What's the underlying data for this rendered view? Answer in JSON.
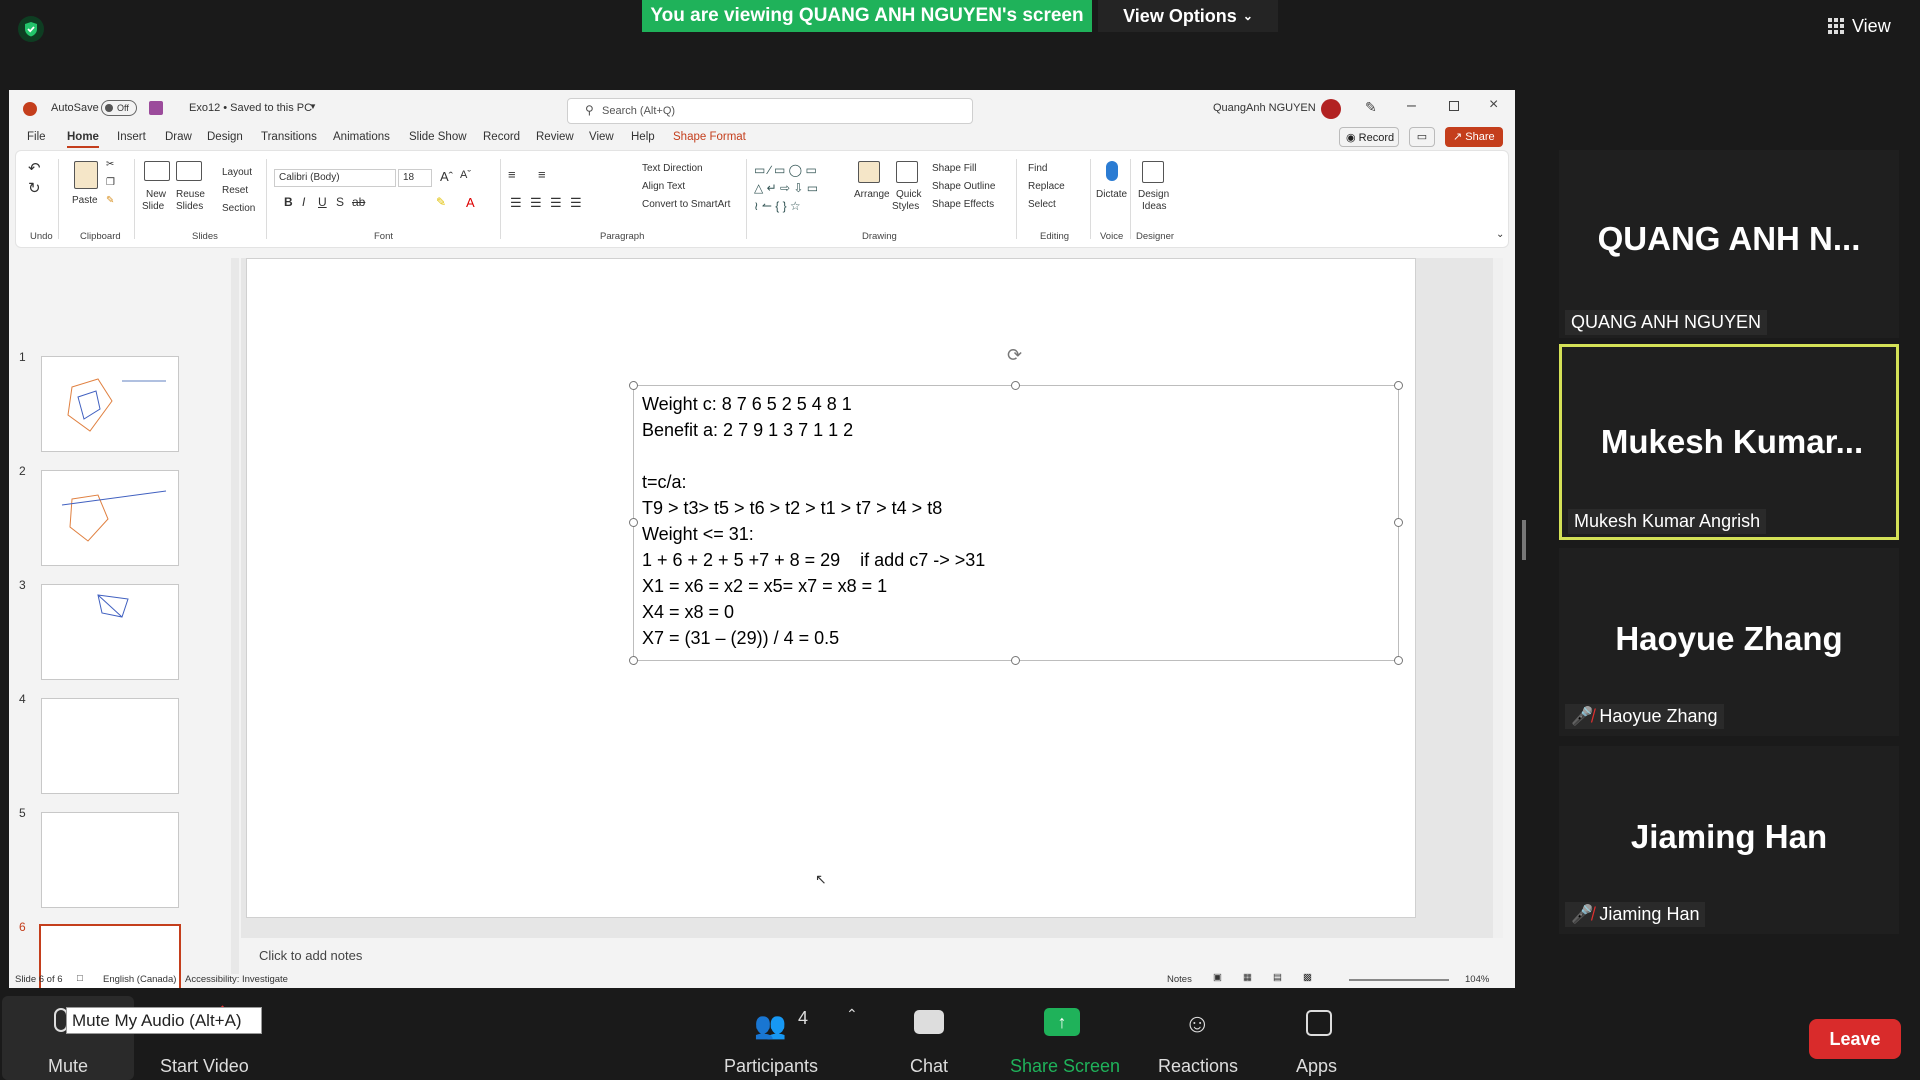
{
  "zoom": {
    "banner": "You are viewing QUANG ANH NGUYEN's screen",
    "view_options": "View Options",
    "view": "View",
    "participants": [
      {
        "big_name": "QUANG ANH N...",
        "label": "QUANG ANH NGUYEN",
        "muted": false
      },
      {
        "big_name": "Mukesh  Kumar...",
        "label": "Mukesh Kumar Angrish",
        "muted": false,
        "active_speaker": true
      },
      {
        "big_name": "Haoyue Zhang",
        "label": "Haoyue Zhang",
        "muted": true
      },
      {
        "big_name": "Jiaming Han",
        "label": "Jiaming Han",
        "muted": true
      }
    ],
    "toolbar": {
      "mute": "Mute",
      "tooltip": "Mute My Audio (Alt+A)",
      "start_video": "Start Video",
      "participants": "Participants",
      "participants_count": "4",
      "chat": "Chat",
      "share_screen": "Share Screen",
      "reactions": "Reactions",
      "apps": "Apps",
      "leave": "Leave"
    },
    "colors": {
      "banner": "#1fb25a",
      "leave": "#d92b2b",
      "active_border": "#d4e157"
    }
  },
  "ppt": {
    "autosave": "AutoSave",
    "autosave_state": "Off",
    "filename": "Exo12 • Saved to this PC",
    "search_placeholder": "Search (Alt+Q)",
    "user": "QuangAnh NGUYEN",
    "tabs": [
      "File",
      "Home",
      "Insert",
      "Draw",
      "Design",
      "Transitions",
      "Animations",
      "Slide Show",
      "Record",
      "Review",
      "View",
      "Help",
      "Shape Format"
    ],
    "active_tab": "Home",
    "record_btn": "Record",
    "share_btn": "Share",
    "ribbon": {
      "undo": "Undo",
      "paste": "Paste",
      "clipboard": "Clipboard",
      "new_slide": "New",
      "new_slide2": "Slide",
      "reuse": "Reuse",
      "reuse2": "Slides",
      "layout": "Layout",
      "reset": "Reset",
      "section": "Section",
      "slides": "Slides",
      "font_name": "Calibri (Body)",
      "font_size": "18",
      "font": "Font",
      "text_direction": "Text Direction",
      "align_text": "Align Text",
      "convert_smartart": "Convert to SmartArt",
      "paragraph": "Paragraph",
      "arrange": "Arrange",
      "quick_styles": "Quick",
      "quick_styles2": "Styles",
      "shape_fill": "Shape Fill",
      "shape_outline": "Shape Outline",
      "shape_effects": "Shape Effects",
      "drawing": "Drawing",
      "find": "Find",
      "replace": "Replace",
      "select": "Select",
      "editing": "Editing",
      "dictate": "Dictate",
      "voice": "Voice",
      "design_ideas": "Design",
      "design_ideas2": "Ideas",
      "designer": "Designer"
    },
    "thumbnails": [
      "1",
      "2",
      "3",
      "4",
      "5",
      "6"
    ],
    "selected_slide": "6",
    "slide_text": [
      "Weight c: 8 7 6 5 2 5 4 8 1",
      "Benefit a: 2 7 9 1 3 7 1 1 2",
      "",
      "t=c/a:",
      "T9 > t3> t5 > t6 > t2 > t1 > t7 > t4 > t8",
      "Weight <= 31:",
      "1 + 6 + 2 + 5 +7 + 8 = 29    if add c7 -> >31",
      "X1 = x6 = x2 = x5= x7 = x8 = 1",
      "X4 = x8 = 0",
      "X7 = (31 – (29)) / 4 = 0.5"
    ],
    "notes_placeholder": "Click to add notes",
    "status": {
      "slide_of": "Slide 6 of 6",
      "language": "English (Canada)",
      "accessibility": "Accessibility: Investigate",
      "notes": "Notes",
      "zoom": "104%"
    }
  }
}
